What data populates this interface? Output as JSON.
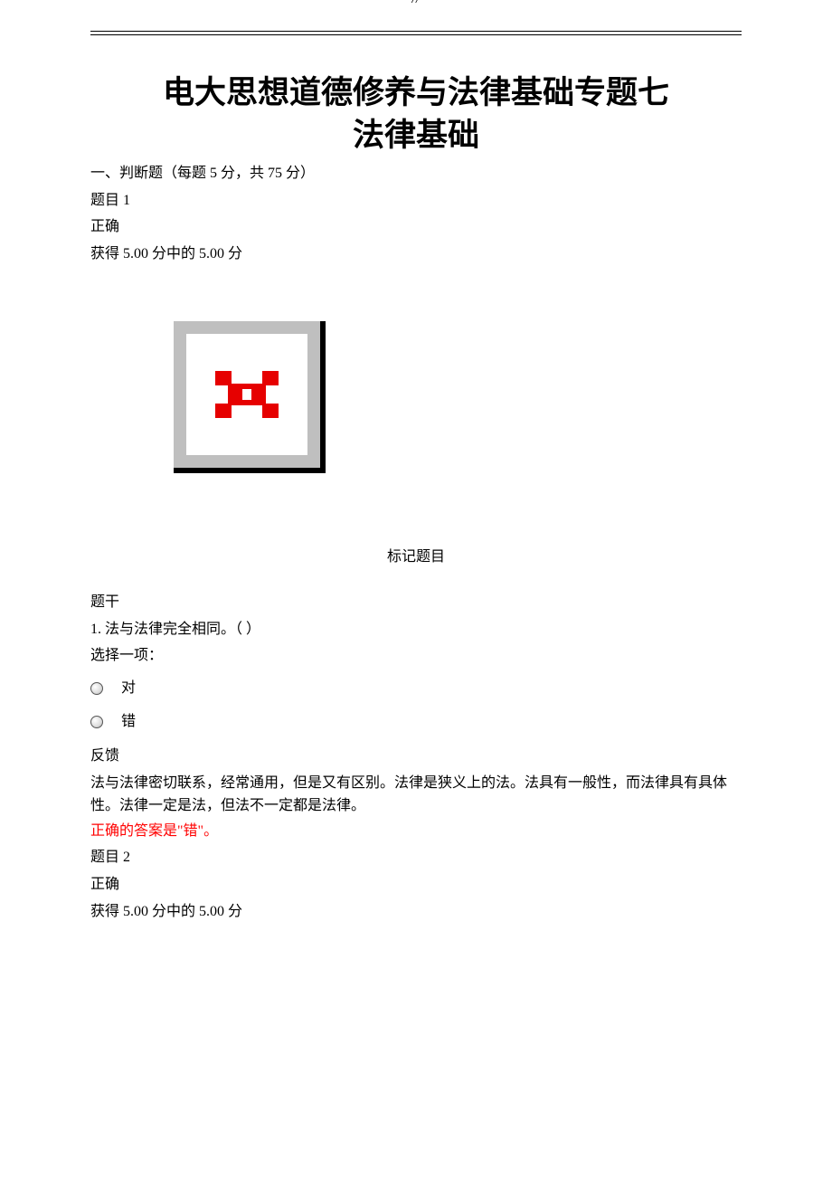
{
  "header_mark": "//",
  "title_line1": "电大思想道德修养与法律基础专题七",
  "title_line2": "法律基础",
  "section_heading": "一、判断题（每题 5 分，共 75 分）",
  "q1": {
    "number_label": "题目 1",
    "status": "正确",
    "score_text": "获得 5.00 分中的 5.00 分",
    "flag_label": "标记题目",
    "stem_label": "题干",
    "stem_text": "1.  法与法律完全相同。（ ）",
    "choose_label": "选择一项：",
    "opt_true": "对",
    "opt_false": "错",
    "feedback_label": "反馈",
    "feedback_text": "法与法律密切联系，经常通用，但是又有区别。法律是狭义上的法。法具有一般性，而法律具有具体性。法律一定是法，但法不一定都是法律。",
    "correct_answer": "正确的答案是\"错\"。"
  },
  "q2": {
    "number_label": "题目 2",
    "status": "正确",
    "score_text": "获得 5.00 分中的 5.00 分"
  }
}
